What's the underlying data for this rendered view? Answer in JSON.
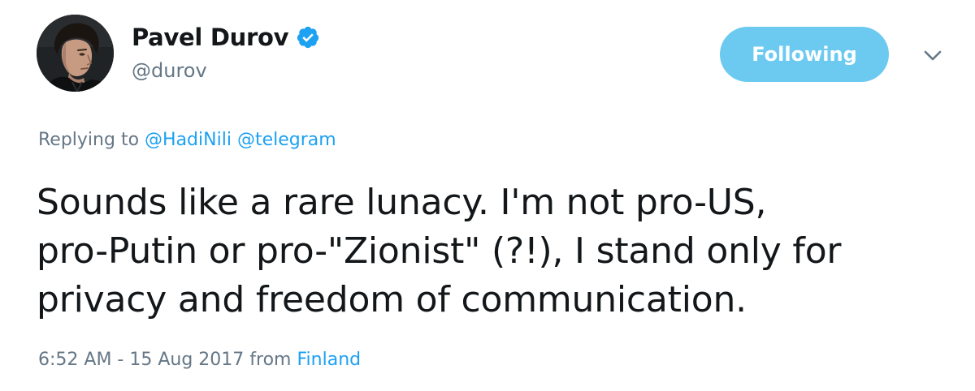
{
  "user": {
    "display_name": "Pavel Durov",
    "handle": "@durov",
    "verified_icon": "verified-badge-icon",
    "avatar": "profile-photo"
  },
  "actions": {
    "follow_label": "Following",
    "menu_icon": "chevron-down-icon"
  },
  "reply_context": {
    "prefix": "Replying to",
    "mentions": [
      "@HadiNili",
      "@telegram"
    ]
  },
  "tweet": {
    "lines": [
      "Sounds like a rare lunacy. I'm not pro-US,",
      "pro-Putin or pro-\"Zionist\" (?!), I stand only for",
      "privacy and freedom of communication."
    ]
  },
  "meta": {
    "timestamp": "6:52 AM - 15 Aug 2017",
    "from_label": "from",
    "location": "Finland"
  },
  "colors": {
    "accent": "#1da1f2",
    "follow_button": "#6ccaf0",
    "secondary_text": "#657786",
    "primary_text": "#14171a"
  }
}
